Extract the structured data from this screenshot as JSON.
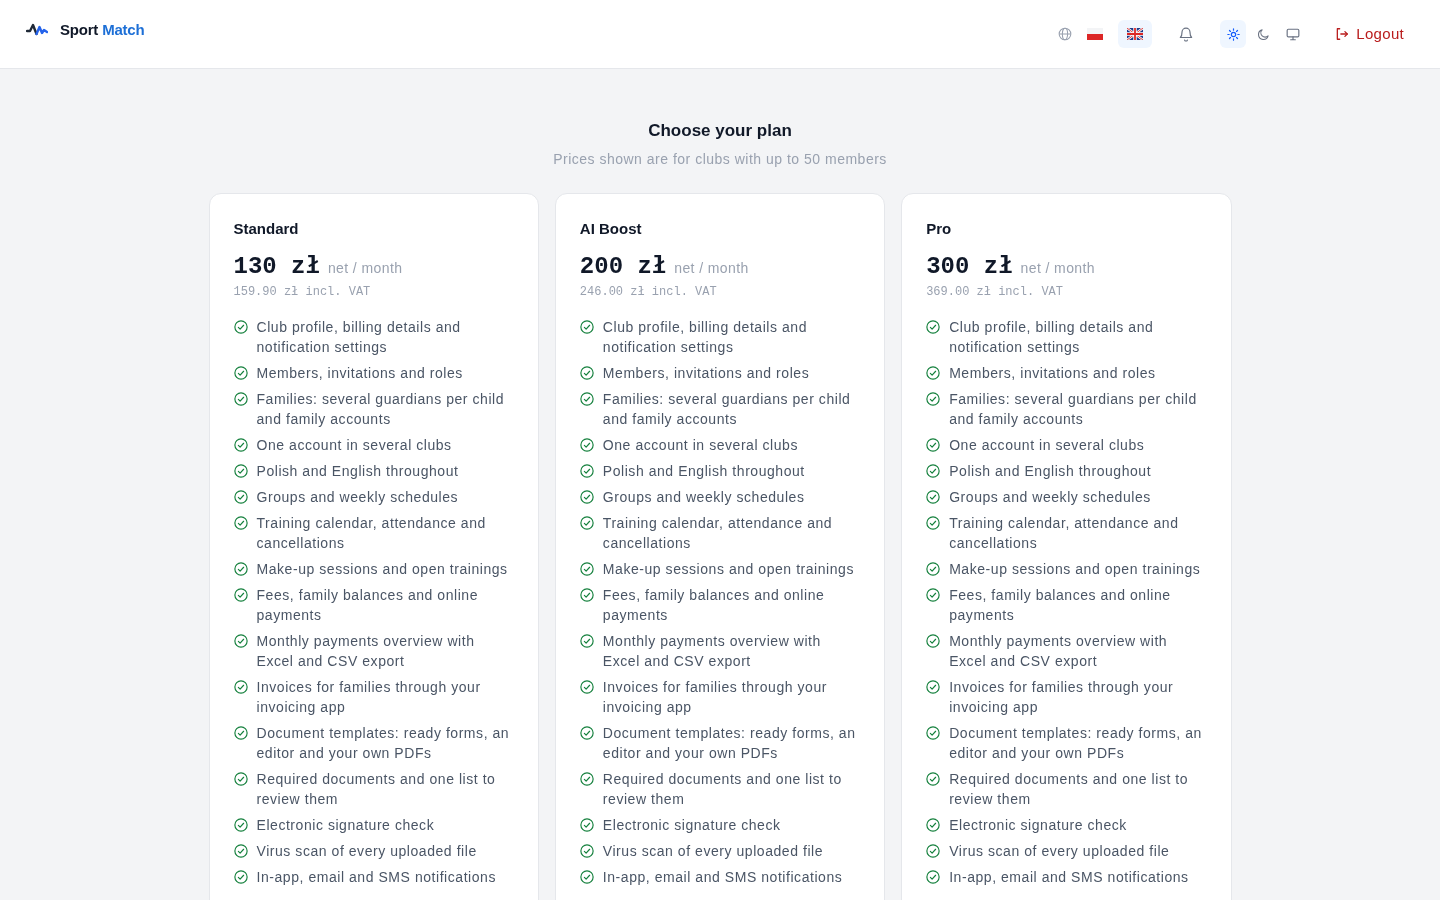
{
  "header": {
    "brand": {
      "name": "Sport",
      "accent": "Match"
    },
    "languages": [
      {
        "kind": "pl",
        "selected": false
      },
      {
        "kind": "gb",
        "selected": true
      }
    ],
    "themes": [
      {
        "kind": "light",
        "selected": true
      },
      {
        "kind": "dark",
        "selected": false
      },
      {
        "kind": "system",
        "selected": false
      }
    ],
    "logout": "Logout"
  },
  "intro": {
    "title": "Choose your plan",
    "subtitle": "Prices shown are for clubs with up to 50 members"
  },
  "plans": [
    {
      "name": "Standard",
      "price": "130 zł",
      "period": "net / month",
      "gross": "159.90 zł incl. VAT",
      "features": [
        "Club profile, billing details and notification settings",
        "Members, invitations and roles",
        "Families: several guardians per child and family accounts",
        "One account in several clubs",
        "Polish and English throughout",
        "Groups and weekly schedules",
        "Training calendar, attendance and cancellations",
        "Make-up sessions and open trainings",
        "Fees, family balances and online payments",
        "Monthly payments overview with Excel and CSV export",
        "Invoices for families through your invoicing app",
        "Document templates: ready forms, an editor and your own PDFs",
        "Required documents and one list to review them",
        "Electronic signature check",
        "Virus scan of every uploaded file",
        "In-app, email and SMS notifications"
      ]
    },
    {
      "name": "AI Boost",
      "price": "200 zł",
      "period": "net / month",
      "gross": "246.00 zł incl. VAT",
      "features": [
        "Club profile, billing details and notification settings",
        "Members, invitations and roles",
        "Families: several guardians per child and family accounts",
        "One account in several clubs",
        "Polish and English throughout",
        "Groups and weekly schedules",
        "Training calendar, attendance and cancellations",
        "Make-up sessions and open trainings",
        "Fees, family balances and online payments",
        "Monthly payments overview with Excel and CSV export",
        "Invoices for families through your invoicing app",
        "Document templates: ready forms, an editor and your own PDFs",
        "Required documents and one list to review them",
        "Electronic signature check",
        "Virus scan of every uploaded file",
        "In-app, email and SMS notifications"
      ]
    },
    {
      "name": "Pro",
      "price": "300 zł",
      "period": "net / month",
      "gross": "369.00 zł incl. VAT",
      "features": [
        "Club profile, billing details and notification settings",
        "Members, invitations and roles",
        "Families: several guardians per child and family accounts",
        "One account in several clubs",
        "Polish and English throughout",
        "Groups and weekly schedules",
        "Training calendar, attendance and cancellations",
        "Make-up sessions and open trainings",
        "Fees, family balances and online payments",
        "Monthly payments overview with Excel and CSV export",
        "Invoices for families through your invoicing app",
        "Document templates: ready forms, an editor and your own PDFs",
        "Required documents and one list to review them",
        "Electronic signature check",
        "Virus scan of every uploaded file",
        "In-app, email and SMS notifications"
      ]
    }
  ]
}
